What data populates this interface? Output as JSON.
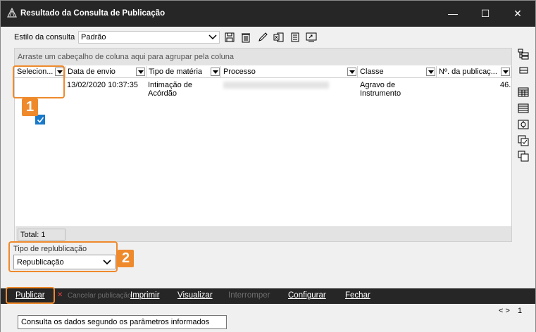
{
  "window": {
    "title": "Resultado da Consulta de Publicação",
    "controls": {
      "minimize": "—",
      "maximize": "☐",
      "close": "✕"
    }
  },
  "query_style": {
    "label": "Estilo da consulta",
    "value": "Padrão",
    "toolbar_icons": [
      "save-icon",
      "trash-icon",
      "pencil-icon",
      "export-icon",
      "document-icon",
      "share-icon"
    ]
  },
  "grid": {
    "group_hint": "Arraste um cabeçalho de coluna aqui para agrupar pela coluna",
    "columns": [
      {
        "label": "Selecion..."
      },
      {
        "label": "Data de envio"
      },
      {
        "label": "Tipo de matéria"
      },
      {
        "label": "Processo"
      },
      {
        "label": "Classe"
      },
      {
        "label": "Nº. da publicaç..."
      }
    ],
    "rows": [
      {
        "selected": true,
        "data_envio": "13/02/2020 10:37:35",
        "tipo_materia": "Intimação de Acórdão",
        "tipo_materia_l1": "Intimação de",
        "tipo_materia_l2": "Acórdão",
        "processo": "",
        "classe_l1": "Agravo de",
        "classe_l2": "Instrumento",
        "numero": "46."
      }
    ],
    "total_label": "Total: 1"
  },
  "callouts": {
    "one": "1",
    "two": "2"
  },
  "republication": {
    "label": "Tipo de replublicação",
    "value": "Republicação"
  },
  "side_icons": [
    "group-columns-icon",
    "collapse-icon",
    "table-icon",
    "list-icon",
    "settings-icon",
    "checklist-icon",
    "copy-icon"
  ],
  "actions": {
    "publicar": "Publicar",
    "cancelar": "Cancelar publicação",
    "imprimir": "Imprimir",
    "visualizar": "Visualizar",
    "interromper": "Interromper",
    "configurar": "Configurar",
    "fechar": "Fechar"
  },
  "status": {
    "tooltip": "Consulta os dados segundo os parâmetros informados",
    "pager_value": "1"
  },
  "colors": {
    "accent": "#ef8a2c",
    "check": "#1979ca",
    "titlebar": "#262626"
  }
}
